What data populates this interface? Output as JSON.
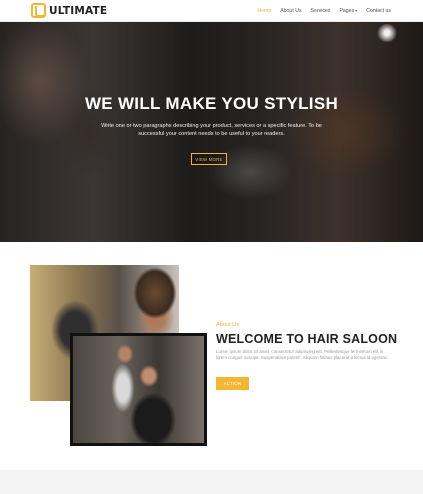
{
  "brand": {
    "logo_letter": "U",
    "name": "ULTIMATE"
  },
  "nav": {
    "items": [
      {
        "label": "Home",
        "active": true
      },
      {
        "label": "About Us",
        "active": false
      },
      {
        "label": "Services",
        "active": false
      },
      {
        "label": "Pages",
        "active": false,
        "dropdown": true
      },
      {
        "label": "Contact us",
        "active": false
      }
    ]
  },
  "hero": {
    "title": "WE WILL MAKE YOU STYLISH",
    "text": "Write one or two paragraphs describing your product, services or a specific feature. To be successful your content needs to be useful to your readers.",
    "button": "VIEW MORE"
  },
  "about": {
    "kicker": "About Us",
    "title": "WELCOME TO HAIR SALOON",
    "text": "Lorem ipsum dolor sit amet, consectetur adipiscing elit. Pellentesque fermentum elit in lorem congue suscipit. Suspendisse potenti. Aliquam finibus placerat a lectus id egestas.",
    "button": "ACTION"
  },
  "colors": {
    "accent": "#f2b632",
    "text_dark": "#222222",
    "text_muted": "#9a9a9a",
    "nav_text": "#555555"
  },
  "icons": {
    "logo": "u-logo-icon",
    "dropdown": "chevron-down-icon"
  }
}
